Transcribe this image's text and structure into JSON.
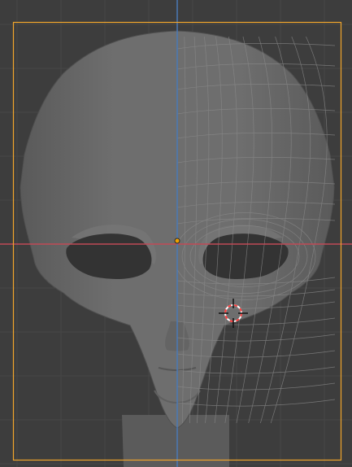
{
  "viewport": {
    "background_color": "#3d3d3d",
    "grid_color": "#474747",
    "x_axis_color": "#c04a56",
    "y_axis_color": "#4a79b6",
    "frame_border_color": "#f2a62c",
    "origin_color": "#f0a000",
    "model_color": "#6c6c6c",
    "wire_color": "#8a8a8a",
    "cursor_ring_colors": [
      "#ff3b3b",
      "#ffffff"
    ],
    "cursor_icon": "3d-cursor-icon",
    "origin_icon": "object-origin-icon"
  }
}
